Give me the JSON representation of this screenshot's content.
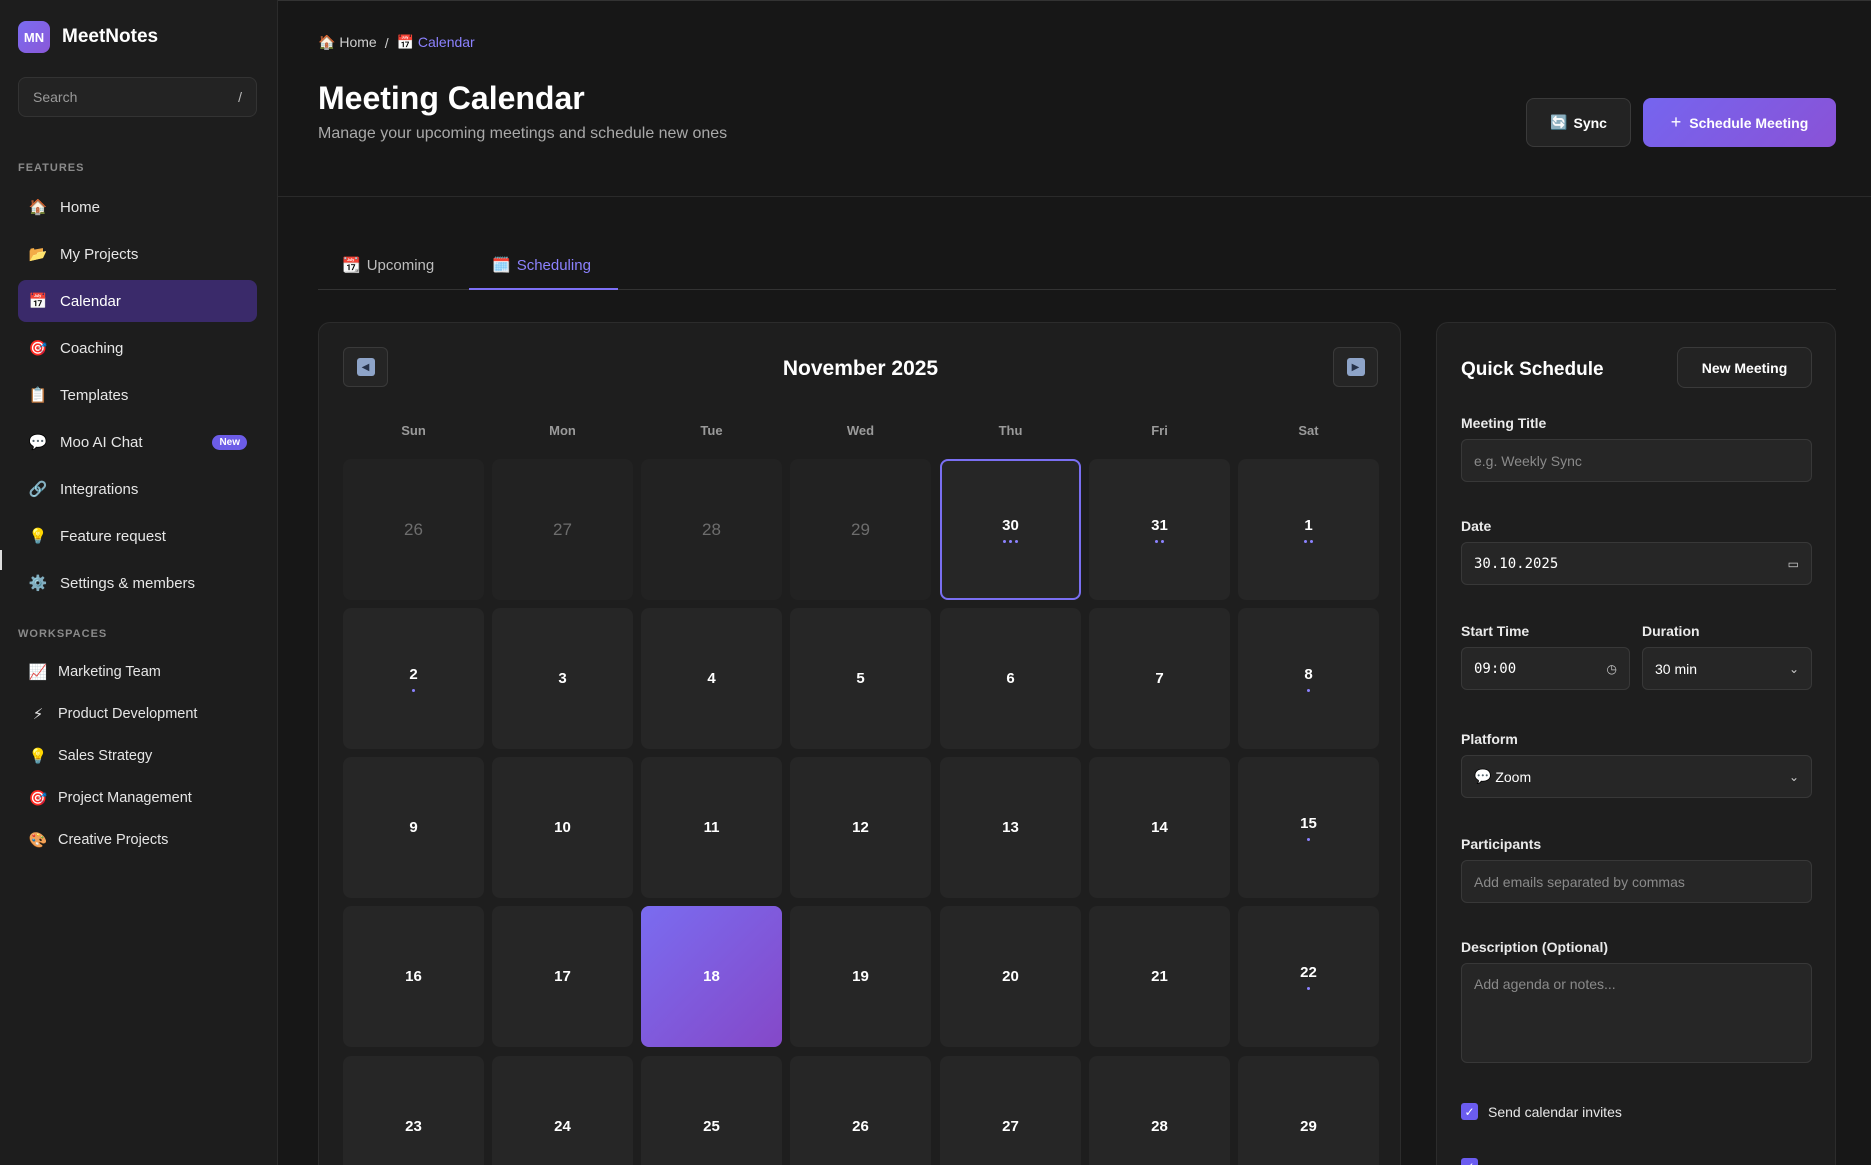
{
  "app": {
    "logo_text": "MN",
    "name": "MeetNotes"
  },
  "search": {
    "placeholder": "Search",
    "shortcut": "/"
  },
  "sidebar": {
    "features_label": "FEATURES",
    "items": [
      {
        "icon": "🏠",
        "label": "Home"
      },
      {
        "icon": "📂",
        "label": "My Projects"
      },
      {
        "icon": "📅",
        "label": "Calendar"
      },
      {
        "icon": "🎯",
        "label": "Coaching"
      },
      {
        "icon": "📋",
        "label": "Templates"
      },
      {
        "icon": "💬",
        "label": "Moo AI Chat",
        "badge": "New"
      },
      {
        "icon": "🔗",
        "label": "Integrations"
      },
      {
        "icon": "💡",
        "label": "Feature request"
      },
      {
        "icon": "⚙️",
        "label": "Settings & members"
      }
    ],
    "workspaces_label": "WORKSPACES",
    "workspaces": [
      {
        "icon": "📈",
        "label": "Marketing Team"
      },
      {
        "icon": "⚡",
        "label": "Product Development"
      },
      {
        "icon": "💡",
        "label": "Sales Strategy"
      },
      {
        "icon": "🎯",
        "label": "Project Management"
      },
      {
        "icon": "🎨",
        "label": "Creative Projects"
      }
    ]
  },
  "breadcrumb": {
    "home_icon": "🏠",
    "home": "Home",
    "sep": "/",
    "current_icon": "📅",
    "current": "Calendar"
  },
  "header": {
    "title": "Meeting Calendar",
    "subtitle": "Manage your upcoming meetings and schedule new ones",
    "sync_icon": "🔄",
    "sync_label": "Sync",
    "schedule_icon": "+",
    "schedule_label": "Schedule Meeting"
  },
  "tabs": [
    {
      "icon": "📆",
      "label": "Upcoming"
    },
    {
      "icon": "🗓️",
      "label": "Scheduling"
    }
  ],
  "calendar": {
    "prev_icon": "◀",
    "next_icon": "▶",
    "month_label": "November 2025",
    "weekdays": [
      "Sun",
      "Mon",
      "Tue",
      "Wed",
      "Thu",
      "Fri",
      "Sat"
    ],
    "weeks": [
      [
        {
          "d": "26",
          "muted": true,
          "dots": 0
        },
        {
          "d": "27",
          "muted": true,
          "dots": 0
        },
        {
          "d": "28",
          "muted": true,
          "dots": 0
        },
        {
          "d": "29",
          "muted": true,
          "dots": 0
        },
        {
          "d": "30",
          "selected": true,
          "dots": 3
        },
        {
          "d": "31",
          "dots": 2
        },
        {
          "d": "1",
          "dots": 2
        }
      ],
      [
        {
          "d": "2",
          "dots": 1
        },
        {
          "d": "3",
          "dots": 0
        },
        {
          "d": "4",
          "dots": 0
        },
        {
          "d": "5",
          "dots": 0
        },
        {
          "d": "6",
          "dots": 0
        },
        {
          "d": "7",
          "dots": 0
        },
        {
          "d": "8",
          "dots": 1
        }
      ],
      [
        {
          "d": "9",
          "dots": 0
        },
        {
          "d": "10",
          "dots": 0
        },
        {
          "d": "11",
          "dots": 0
        },
        {
          "d": "12",
          "dots": 0
        },
        {
          "d": "13",
          "dots": 0
        },
        {
          "d": "14",
          "dots": 0
        },
        {
          "d": "15",
          "dots": 1
        }
      ],
      [
        {
          "d": "16",
          "dots": 0
        },
        {
          "d": "17",
          "dots": 0
        },
        {
          "d": "18",
          "today": true,
          "dots": 0
        },
        {
          "d": "19",
          "dots": 0
        },
        {
          "d": "20",
          "dots": 0
        },
        {
          "d": "21",
          "dots": 0
        },
        {
          "d": "22",
          "dots": 1
        }
      ],
      [
        {
          "d": "23",
          "dots": 0
        },
        {
          "d": "24",
          "dots": 0
        },
        {
          "d": "25",
          "dots": 0
        },
        {
          "d": "26",
          "dots": 0
        },
        {
          "d": "27",
          "dots": 0
        },
        {
          "d": "28",
          "dots": 0
        },
        {
          "d": "29",
          "dots": 0
        }
      ]
    ]
  },
  "quick_schedule": {
    "title": "Quick Schedule",
    "new_meeting_label": "New Meeting",
    "meeting_title_label": "Meeting Title",
    "meeting_title_placeholder": "e.g. Weekly Sync",
    "date_label": "Date",
    "date_value": "30.10.2025",
    "start_time_label": "Start Time",
    "start_time_value": "09:00",
    "duration_label": "Duration",
    "duration_value": "30 min",
    "platform_label": "Platform",
    "platform_icon": "💬",
    "platform_value": "Zoom",
    "participants_label": "Participants",
    "participants_placeholder": "Add emails separated by commas",
    "description_label": "Description (Optional)",
    "description_placeholder": "Add agenda or notes...",
    "send_invites_label": "Send calendar invites",
    "send_invites_checked": true
  },
  "colors": {
    "accent": "#7d70f5",
    "background": "#171717",
    "sidebar": "#1d1d1d",
    "active_nav": "#3a2a6a"
  }
}
